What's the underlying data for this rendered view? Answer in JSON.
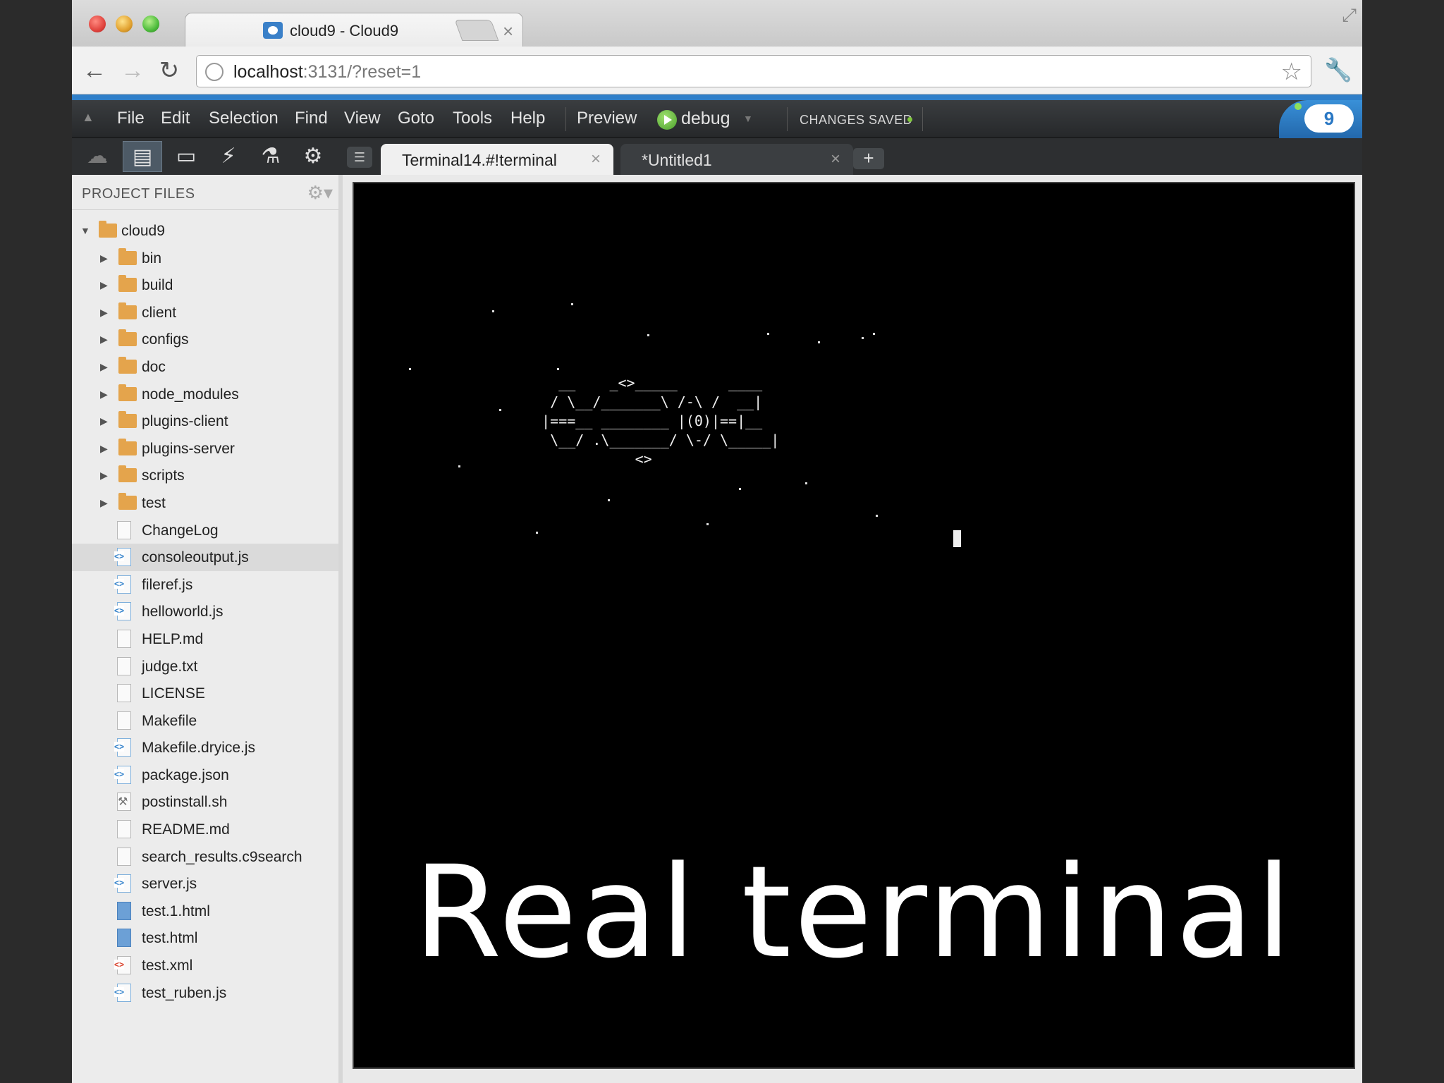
{
  "browser": {
    "tab_title": "cloud9 - Cloud9",
    "tab_close": "×",
    "url_host": "localhost",
    "url_rest": ":3131/?reset=1"
  },
  "menubar": {
    "items": [
      "File",
      "Edit",
      "Selection",
      "Find",
      "View",
      "Goto",
      "Tools",
      "Help",
      "Preview"
    ],
    "debug_label": "debug",
    "status": "CHANGES SAVED",
    "logo_text": "9"
  },
  "editor_tabs": [
    {
      "label": "Terminal14.#!terminal",
      "close": "×",
      "active": true
    },
    {
      "label": "*Untitled1",
      "close": "×",
      "active": false
    }
  ],
  "add_tab_label": "+",
  "sidebar": {
    "title": "PROJECT FILES",
    "tree": [
      {
        "name": "cloud9",
        "type": "folder",
        "expanded": true,
        "depth": 0
      },
      {
        "name": "bin",
        "type": "folder",
        "depth": 1
      },
      {
        "name": "build",
        "type": "folder",
        "depth": 1
      },
      {
        "name": "client",
        "type": "folder",
        "depth": 1
      },
      {
        "name": "configs",
        "type": "folder",
        "depth": 1
      },
      {
        "name": "doc",
        "type": "folder",
        "depth": 1
      },
      {
        "name": "node_modules",
        "type": "folder",
        "depth": 1
      },
      {
        "name": "plugins-client",
        "type": "folder",
        "depth": 1
      },
      {
        "name": "plugins-server",
        "type": "folder",
        "depth": 1
      },
      {
        "name": "scripts",
        "type": "folder",
        "depth": 1
      },
      {
        "name": "test",
        "type": "folder",
        "depth": 1
      },
      {
        "name": "ChangeLog",
        "type": "file",
        "depth": 1
      },
      {
        "name": "consoleoutput.js",
        "type": "js",
        "depth": 1,
        "selected": true
      },
      {
        "name": "fileref.js",
        "type": "js",
        "depth": 1
      },
      {
        "name": "helloworld.js",
        "type": "js",
        "depth": 1
      },
      {
        "name": "HELP.md",
        "type": "file",
        "depth": 1
      },
      {
        "name": "judge.txt",
        "type": "file",
        "depth": 1
      },
      {
        "name": "LICENSE",
        "type": "file",
        "depth": 1
      },
      {
        "name": "Makefile",
        "type": "file",
        "depth": 1
      },
      {
        "name": "Makefile.dryice.js",
        "type": "js",
        "depth": 1
      },
      {
        "name": "package.json",
        "type": "js",
        "depth": 1
      },
      {
        "name": "postinstall.sh",
        "type": "sh",
        "depth": 1
      },
      {
        "name": "README.md",
        "type": "file",
        "depth": 1
      },
      {
        "name": "search_results.c9search",
        "type": "file",
        "depth": 1
      },
      {
        "name": "server.js",
        "type": "js",
        "depth": 1
      },
      {
        "name": "test.1.html",
        "type": "html",
        "depth": 1
      },
      {
        "name": "test.html",
        "type": "html",
        "depth": 1
      },
      {
        "name": "test.xml",
        "type": "xml",
        "depth": 1
      },
      {
        "name": "test_ruben.js",
        "type": "js",
        "depth": 1
      }
    ]
  },
  "terminal": {
    "ascii_art": "     __    _<>_____      ____\n    / \\__/_______\\ /-\\ /  __|\n   |===__ ________ |(0)|==|__\n    \\__/ .\\_______/ \\-/ \\_____|\n              <>",
    "caption": "Real terminal"
  }
}
